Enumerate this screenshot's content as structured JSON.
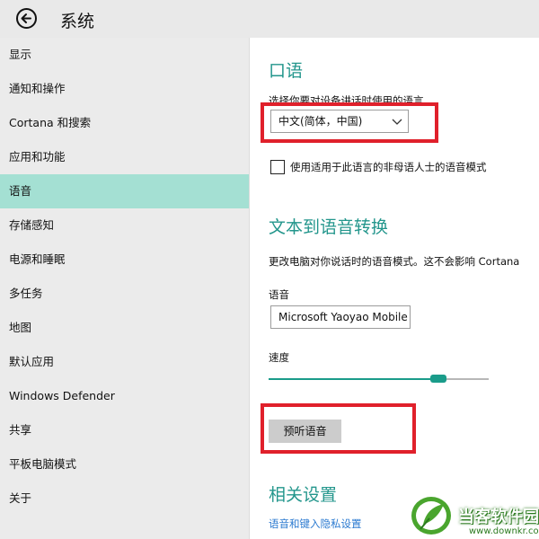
{
  "app": {
    "title": "系统"
  },
  "sidebar": {
    "items": [
      {
        "label": "显示"
      },
      {
        "label": "通知和操作"
      },
      {
        "label": "Cortana 和搜索"
      },
      {
        "label": "应用和功能"
      },
      {
        "label": "语音",
        "active": true
      },
      {
        "label": "存储感知"
      },
      {
        "label": "电源和睡眠"
      },
      {
        "label": "多任务"
      },
      {
        "label": "地图"
      },
      {
        "label": "默认应用"
      },
      {
        "label": "Windows Defender"
      },
      {
        "label": "共享"
      },
      {
        "label": "平板电脑模式"
      },
      {
        "label": "关于"
      }
    ]
  },
  "speech": {
    "title": "口语",
    "prompt": "选择你要对设备讲话时使用的语言",
    "language_value": "中文(简体，中国)",
    "checkbox_label": "使用适用于此语言的非母语人士的语音模式",
    "checkbox_checked": false
  },
  "tts": {
    "title": "文本到语音转换",
    "desc": "更改电脑对你说话时的语音模式。这不会影响 Cortana",
    "voice_label": "语音",
    "voice_value": "Microsoft Yaoyao Mobile",
    "speed_label": "速度",
    "speed_fraction": 0.75,
    "preview_label": "预听语音"
  },
  "related": {
    "title": "相关设置",
    "link": "语音和键入隐私设置"
  },
  "watermark": {
    "name": "当客软件园",
    "url": "www.downkr.com"
  },
  "colors": {
    "accent": "#23968c",
    "highlight": "#a4e0d3",
    "annotation_red": "#e0202b",
    "link": "#2b7ad0"
  },
  "icons": {
    "back": "back-arrow-icon",
    "dropdown": "chevron-down-icon"
  }
}
